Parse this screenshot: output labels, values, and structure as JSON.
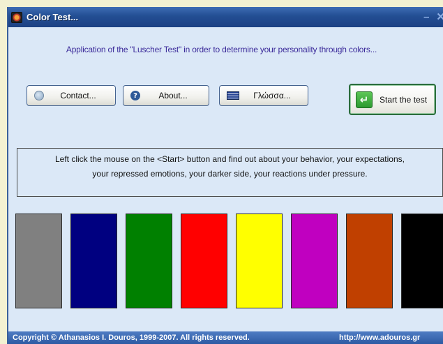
{
  "window": {
    "title": "Color Test...",
    "minimize_glyph": "–",
    "close_glyph": "✕"
  },
  "subtitle": "Application of the \"Luscher Test\" in order to determine your personality through colors...",
  "buttons": {
    "contact": "Contact...",
    "about": "About...",
    "language": "Γλώσσα...",
    "start": "Start the test"
  },
  "icons": {
    "contact": "globe-icon",
    "about": "question-icon",
    "language": "greek-flag-icon",
    "start": "enter-arrow-icon"
  },
  "instructions": {
    "line1": "Left click the mouse on the <Start> button and find out about your behavior, your expectations,",
    "line2": "your repressed emotions, your darker side, your reactions under pressure."
  },
  "colors": [
    {
      "name": "grey",
      "hex": "#808080"
    },
    {
      "name": "dark-blue",
      "hex": "#000080"
    },
    {
      "name": "green",
      "hex": "#008000"
    },
    {
      "name": "red",
      "hex": "#ff0000"
    },
    {
      "name": "yellow",
      "hex": "#ffff00"
    },
    {
      "name": "violet",
      "hex": "#c000c0"
    },
    {
      "name": "brown",
      "hex": "#c04000"
    },
    {
      "name": "black",
      "hex": "#000000"
    }
  ],
  "statusbar": {
    "copyright": "Copyright © Athanasios I. Douros, 1999-2007.  All rights reserved.",
    "website": "http://www.adouros.gr"
  }
}
